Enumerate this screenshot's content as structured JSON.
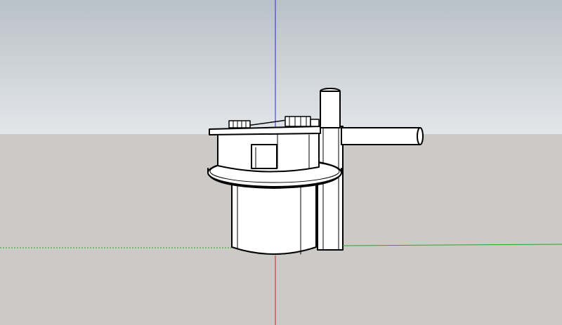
{
  "viewport": {
    "view": "3d-modeling-scene",
    "colors": {
      "sky_top": "#b9c1c8",
      "sky_bottom": "#e3e6e9",
      "ground": "#cbcac6",
      "axis_blue": "#2b2bd0",
      "axis_red": "#c22222",
      "axis_green": "#2ea12e",
      "model_fill": "#ffffff",
      "model_shade": "#eeeeee",
      "model_stroke": "#000000"
    },
    "model": {
      "name": "white-cylindrical-machine-model",
      "parts": [
        "upper-cylinder",
        "middle-ring",
        "lower-cylinder",
        "vertical-post",
        "horizontal-arm",
        "top-plate",
        "top-details"
      ]
    }
  }
}
